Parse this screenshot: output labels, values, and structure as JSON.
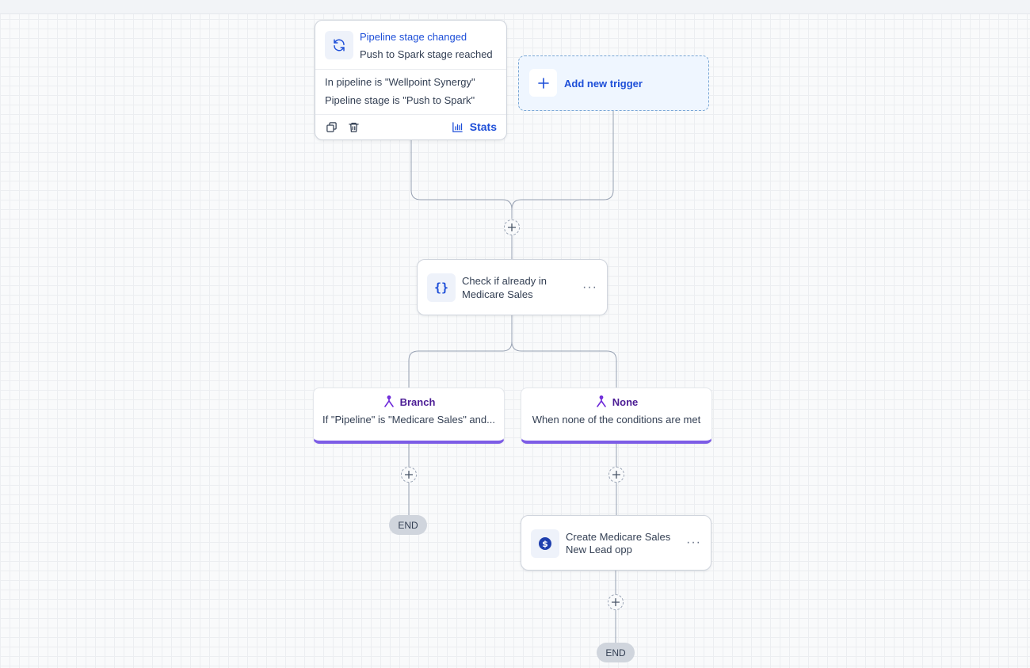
{
  "trigger": {
    "title": "Pipeline stage changed",
    "subtitle": "Push to Spark stage reached",
    "conditions": [
      "In pipeline is \"Wellpoint Synergy\"",
      "Pipeline stage is \"Push to Spark\""
    ],
    "stats_label": "Stats",
    "icons": {
      "main": "refresh-icon",
      "copy": "copy-icon",
      "delete": "trash-icon",
      "stats": "bar-chart-icon"
    }
  },
  "add_trigger": {
    "label": "Add new trigger",
    "icon": "plus-icon"
  },
  "check_node": {
    "line1": "Check if already in",
    "line2": "Medicare Sales",
    "icon": "code-braces-icon",
    "more": "···"
  },
  "branches": [
    {
      "title": "Branch",
      "description": "If \"Pipeline\" is \"Medicare Sales\" and...",
      "icon": "branch-icon"
    },
    {
      "title": "None",
      "description": "When none of the conditions are met",
      "icon": "branch-icon"
    }
  ],
  "create_node": {
    "line1": "Create Medicare Sales",
    "line2": "New Lead opp",
    "icon": "dollar-icon",
    "more": "···"
  },
  "end_label": "END",
  "colors": {
    "accent": "#1d4ed8",
    "branch": "#7c5ce6",
    "dollar_icon": "#1e3fae"
  }
}
